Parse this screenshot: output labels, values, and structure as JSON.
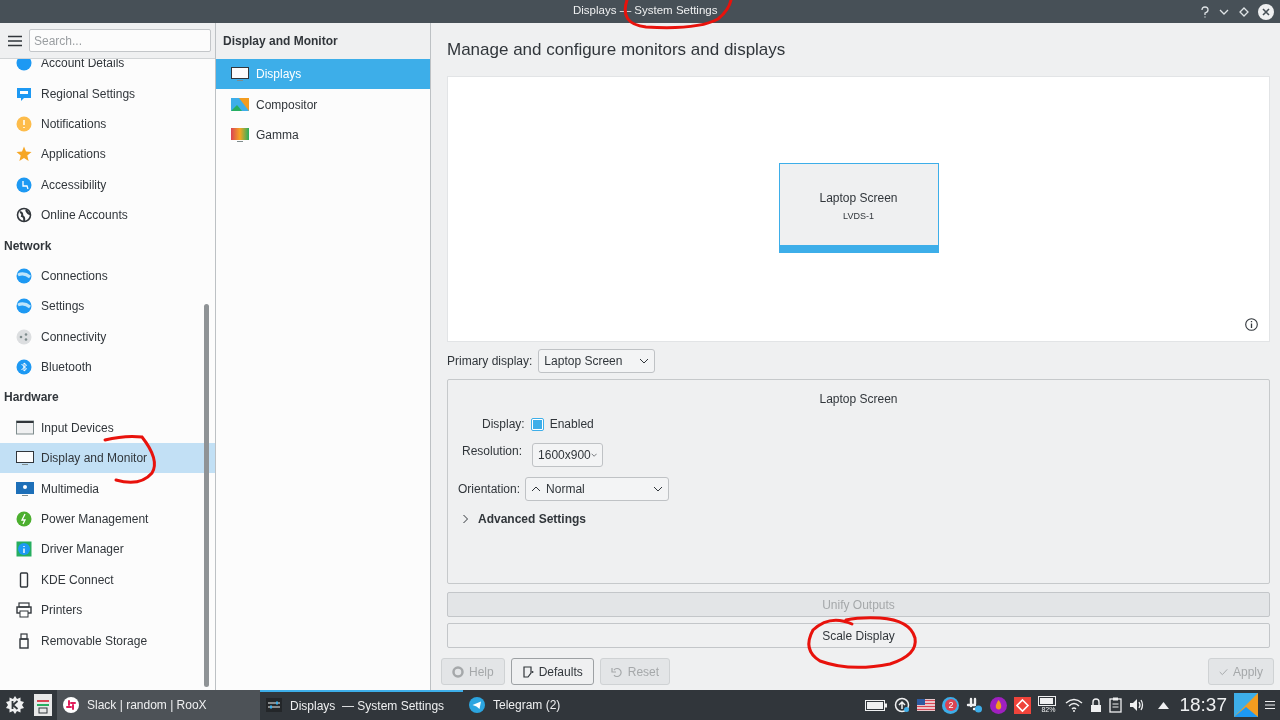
{
  "window": {
    "title": "Displays — System Settings"
  },
  "sidebar": {
    "search": {
      "placeholder": "Search..."
    },
    "entries": [
      {
        "kind": "item",
        "label": "Account Details",
        "selected": false
      },
      {
        "kind": "item",
        "label": "Regional Settings",
        "selected": false
      },
      {
        "kind": "item",
        "label": "Notifications",
        "selected": false
      },
      {
        "kind": "item",
        "label": "Applications",
        "selected": false
      },
      {
        "kind": "item",
        "label": "Accessibility",
        "selected": false
      },
      {
        "kind": "item",
        "label": "Online Accounts",
        "selected": false
      },
      {
        "kind": "heading",
        "label": "Network"
      },
      {
        "kind": "item",
        "label": "Connections",
        "selected": false
      },
      {
        "kind": "item",
        "label": "Settings",
        "selected": false
      },
      {
        "kind": "item",
        "label": "Connectivity",
        "selected": false
      },
      {
        "kind": "item",
        "label": "Bluetooth",
        "selected": false
      },
      {
        "kind": "heading",
        "label": "Hardware"
      },
      {
        "kind": "item",
        "label": "Input Devices",
        "selected": false
      },
      {
        "kind": "item",
        "label": "Display and Monitor",
        "selected": true
      },
      {
        "kind": "item",
        "label": "Multimedia",
        "selected": false
      },
      {
        "kind": "item",
        "label": "Power Management",
        "selected": false
      },
      {
        "kind": "item",
        "label": "Driver Manager",
        "selected": false
      },
      {
        "kind": "item",
        "label": "KDE Connect",
        "selected": false
      },
      {
        "kind": "item",
        "label": "Printers",
        "selected": false
      },
      {
        "kind": "item",
        "label": "Removable Storage",
        "selected": false
      }
    ]
  },
  "category": {
    "title": "Display and Monitor",
    "items": [
      {
        "label": "Displays",
        "selected": true
      },
      {
        "label": "Compositor",
        "selected": false
      },
      {
        "label": "Gamma",
        "selected": false
      }
    ]
  },
  "main": {
    "heading": "Manage and configure monitors and displays",
    "monitor": {
      "name": "Laptop Screen",
      "connector": "LVDS-1"
    },
    "primary_display": {
      "label": "Primary display:",
      "value": "Laptop Screen"
    },
    "output": {
      "title": "Laptop Screen",
      "display_label": "Display:",
      "enabled_label": "Enabled",
      "enabled": true,
      "resolution_label": "Resolution:",
      "resolution": "1600x900",
      "orientation_label": "Orientation:",
      "orientation": "Normal",
      "advanced_label": "Advanced Settings",
      "expanded": false
    },
    "buttons": [
      {
        "label": "Unify Outputs",
        "disabled": true
      },
      {
        "label": "Scale Display",
        "disabled": false
      }
    ],
    "footer_buttons": [
      {
        "label": "Help",
        "disabled": true
      },
      {
        "label": "Defaults",
        "disabled": false
      },
      {
        "label": "Reset",
        "disabled": true
      },
      {
        "label": "Apply",
        "disabled": true
      }
    ]
  },
  "taskbar": {
    "tasks": [
      {
        "label": "Slack | random | RooX",
        "active": false
      },
      {
        "label": "Displays  — System Settings",
        "active": true
      },
      {
        "label": "Telegram (2)",
        "active": false
      }
    ],
    "badge": "2",
    "battery_percent": "82%",
    "clock": "18:37"
  }
}
